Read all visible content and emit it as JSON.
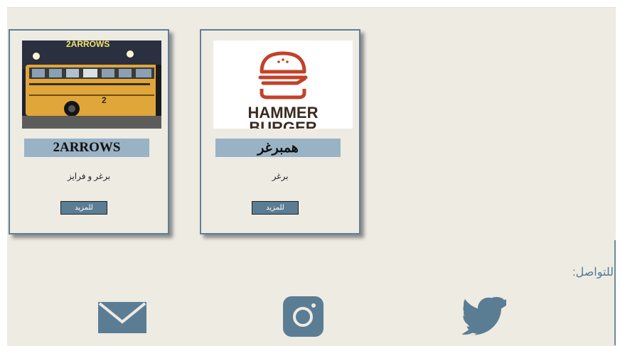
{
  "cards": [
    {
      "title": "2ARROWS",
      "description": "برغر و فرايز",
      "more_label": "للمزيد",
      "image_sign": "2ARROWS"
    },
    {
      "title": "همبرغر",
      "description": "برغر",
      "more_label": "للمزيد",
      "logo_line1": "HAMMER",
      "logo_line2": "BURGER"
    }
  ],
  "contact": {
    "label": "للتواصل:"
  },
  "social": [
    "envelope-icon",
    "instagram-icon",
    "twitter-icon"
  ],
  "colors": {
    "background": "#eeebe3",
    "accent": "#5b7d94",
    "title_bar": "#99b3c5",
    "logo_red": "#c2412b"
  }
}
